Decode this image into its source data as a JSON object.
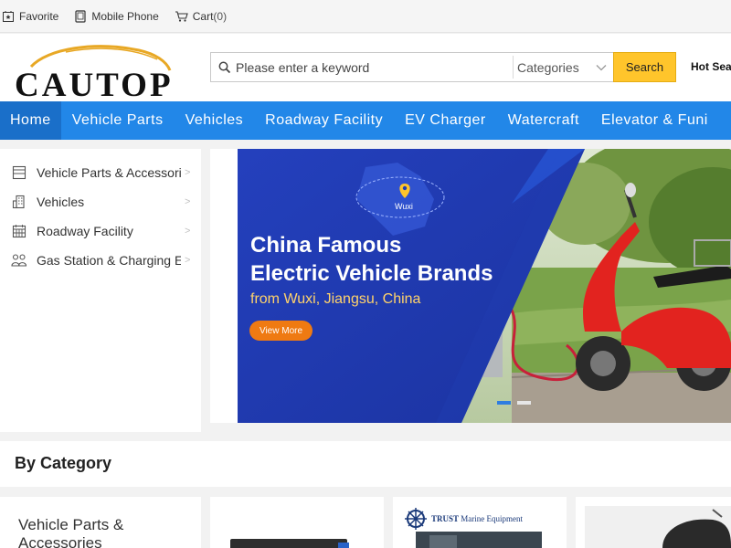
{
  "topbar": {
    "favorite": "Favorite",
    "mobile_phone": "Mobile Phone",
    "cart_label": "Cart",
    "cart_count": "(0)"
  },
  "header": {
    "logo_text": "CAUTOP",
    "search_placeholder": "Please enter a keyword",
    "category_select": "Categories",
    "search_button": "Search",
    "hot_search": "Hot Sea"
  },
  "nav": {
    "items": [
      {
        "label": "Home",
        "active": true
      },
      {
        "label": "Vehicle Parts"
      },
      {
        "label": "Vehicles"
      },
      {
        "label": "Roadway Facility"
      },
      {
        "label": "EV Charger"
      },
      {
        "label": "Watercraft"
      },
      {
        "label": "Elevator & Funi"
      }
    ]
  },
  "sidebar": {
    "items": [
      {
        "label": "Vehicle Parts & Accessori",
        "icon": "archive-box-icon",
        "arrow": ">"
      },
      {
        "label": "Vehicles",
        "icon": "building-icon",
        "arrow": ">"
      },
      {
        "label": "Roadway Facility",
        "icon": "calendar-grid-icon",
        "arrow": ">"
      },
      {
        "label": "Gas Station & Charging E",
        "icon": "people-group-icon",
        "arrow": ">"
      }
    ]
  },
  "banner": {
    "title_line1": "China Famous",
    "title_line2": "Electric Vehicle Brands",
    "subtitle": "from Wuxi, Jiangsu, China",
    "button": "View More",
    "map_label": "Wuxi",
    "slide_count": 2,
    "active_slide": 1
  },
  "category": {
    "heading": "By Category",
    "cards": [
      {
        "title": "Vehicle Parts & Accessories"
      },
      {
        "title": ""
      },
      {
        "title": "",
        "brand_bold": "TRUST",
        "brand_rest": " Marine Equipment"
      },
      {
        "title": ""
      }
    ]
  },
  "colors": {
    "nav_bg": "#2287e8",
    "nav_active": "#1a6fc9",
    "search_button": "#ffc52b",
    "banner_blue": "#1e3fb3",
    "banner_button": "#ef7a12"
  }
}
